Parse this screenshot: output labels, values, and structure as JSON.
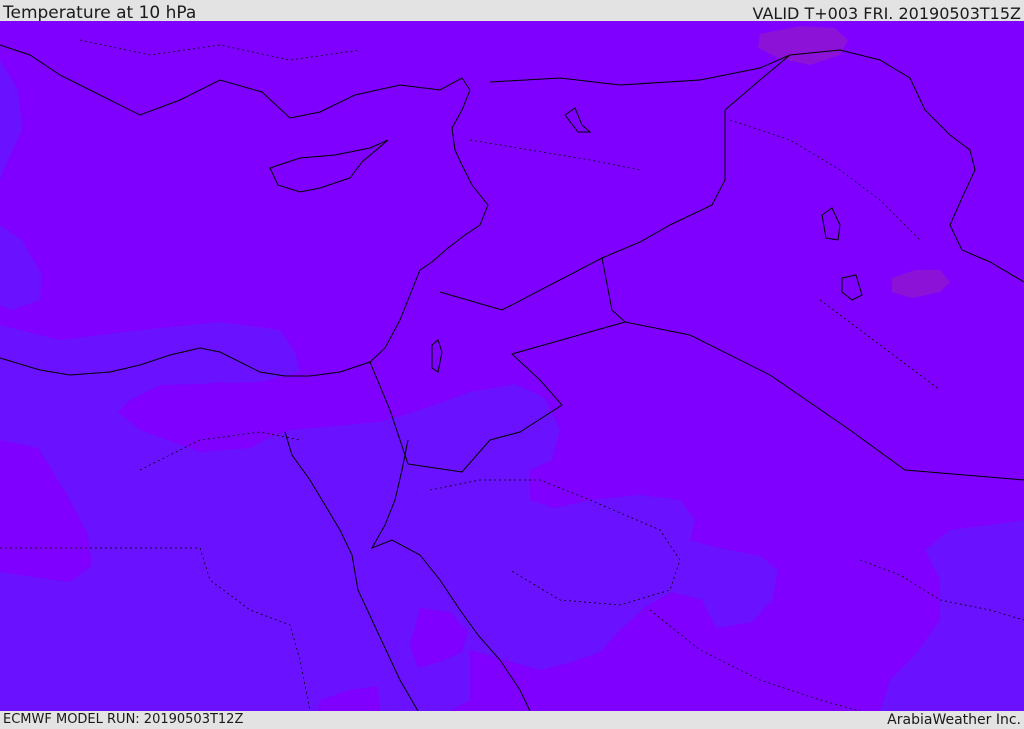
{
  "header": {
    "title": "Temperature at 10 hPa",
    "valid": "VALID T+003 FRI. 20190503T15Z"
  },
  "footer": {
    "model_run": "ECMWF MODEL RUN: 20190503T12Z",
    "credit": "ArabiaWeather Inc."
  },
  "colors": {
    "background": "#7f00ff",
    "cooler_zone": "#6a12ff",
    "warm_spot": "#8c12d8",
    "coastline": "#000000",
    "frame": "#e3e3e3"
  }
}
